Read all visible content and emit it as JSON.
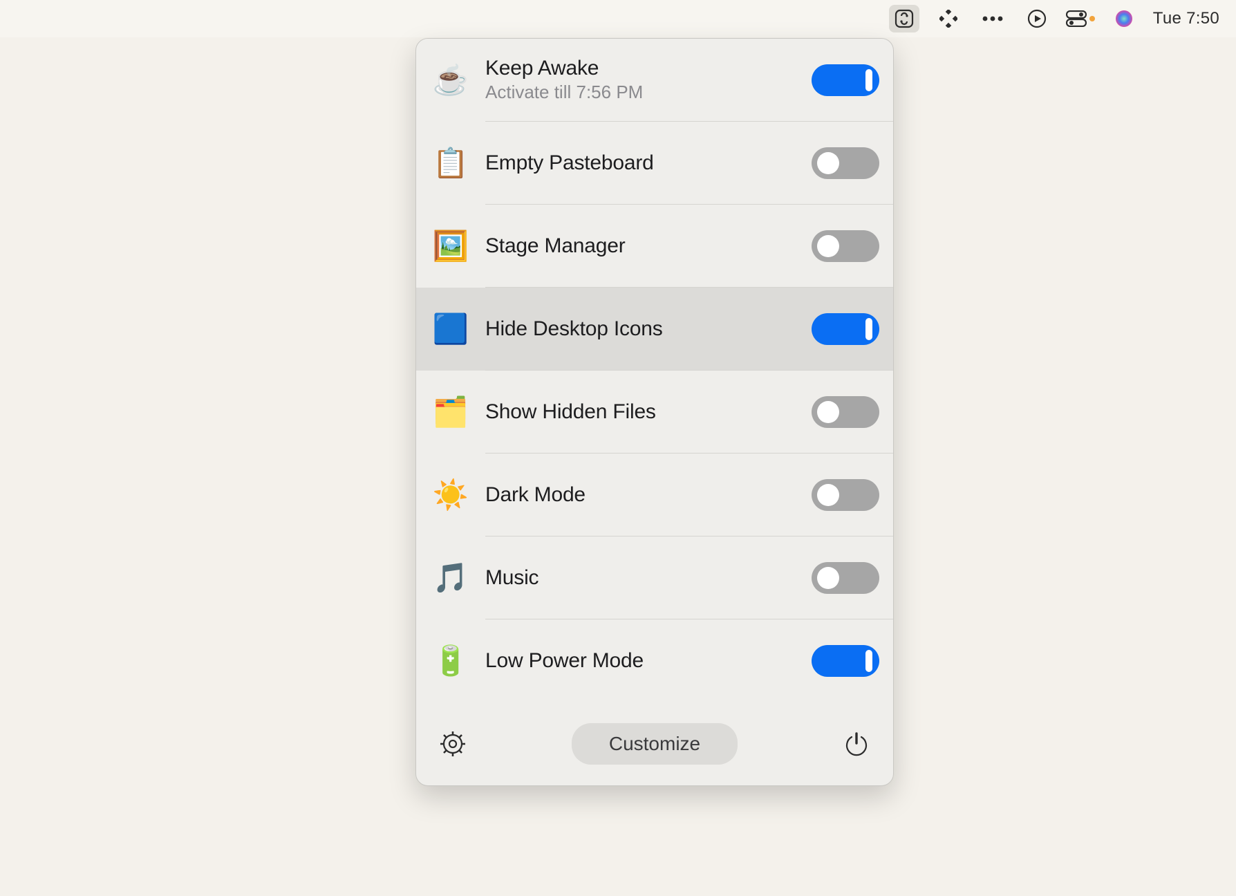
{
  "menubar": {
    "time": "Tue 7:50"
  },
  "panel": {
    "items": [
      {
        "icon": "☕",
        "title": "Keep Awake",
        "subtitle": "Activate till 7:56 PM",
        "on": true,
        "highlighted": false,
        "name": "keep-awake"
      },
      {
        "icon": "📋",
        "title": "Empty Pasteboard",
        "subtitle": "",
        "on": false,
        "highlighted": false,
        "name": "empty-pasteboard"
      },
      {
        "icon": "🖼️",
        "title": "Stage Manager",
        "subtitle": "",
        "on": false,
        "highlighted": false,
        "name": "stage-manager"
      },
      {
        "icon": "🟦",
        "title": "Hide Desktop Icons",
        "subtitle": "",
        "on": true,
        "highlighted": true,
        "name": "hide-desktop-icons"
      },
      {
        "icon": "🗂️",
        "title": "Show Hidden Files",
        "subtitle": "",
        "on": false,
        "highlighted": false,
        "name": "show-hidden-files"
      },
      {
        "icon": "☀️",
        "title": "Dark Mode",
        "subtitle": "",
        "on": false,
        "highlighted": false,
        "name": "dark-mode"
      },
      {
        "icon": "🎵",
        "title": "Music",
        "subtitle": "",
        "on": false,
        "highlighted": false,
        "name": "music"
      },
      {
        "icon": "🔋",
        "title": "Low Power Mode",
        "subtitle": "",
        "on": true,
        "highlighted": false,
        "name": "low-power-mode"
      }
    ],
    "footer": {
      "customize_label": "Customize"
    }
  }
}
